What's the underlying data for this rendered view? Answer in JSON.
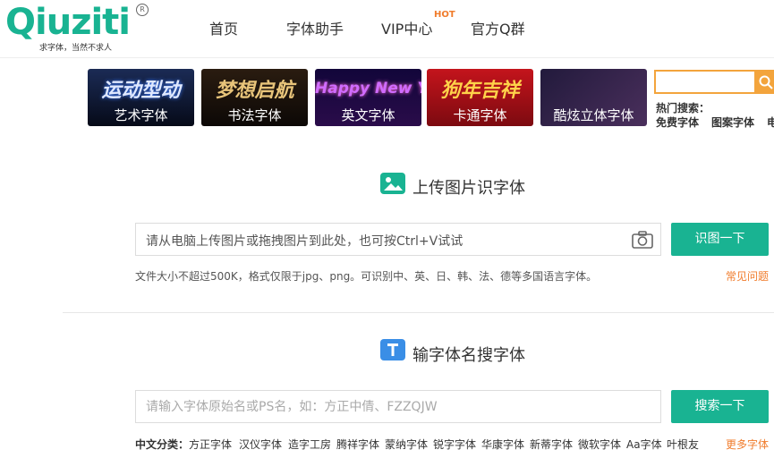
{
  "brand": {
    "name": "Qiuziti",
    "slogan": "求字体，当然不求人",
    "registered": "R"
  },
  "nav": {
    "items": [
      "首页",
      "字体助手",
      "VIP中心",
      "官方Q群"
    ],
    "hot_badge": "HOT"
  },
  "banners": [
    {
      "art": "运动型动",
      "caption": "艺术字体"
    },
    {
      "art": "梦想启航",
      "caption": "书法字体"
    },
    {
      "art": "Happy New Year",
      "caption": "英文字体"
    },
    {
      "art": "狗年吉祥",
      "caption": "卡通字体"
    },
    {
      "art": "",
      "caption": "酷炫立体字体"
    }
  ],
  "hot_search": {
    "label": "热门搜索：",
    "links": [
      "免费字体",
      "图案字体",
      "电"
    ]
  },
  "upload_section": {
    "title": "上传图片识字体",
    "placeholder": "请从电脑上传图片或拖拽图片到此处，也可按Ctrl+V试试",
    "button": "识图一下",
    "note": "文件大小不超过500K，格式仅限于jpg、png。可识别中、英、日、韩、法、德等多国语言字体。",
    "faq": "常见问题"
  },
  "name_section": {
    "title": "输字体名搜字体",
    "placeholder": "请输入字体原始名或PS名，如：方正中倩、FZZQJW",
    "button": "搜索一下",
    "category_label": "中文分类：",
    "categories": [
      "方正字体",
      "汉仪字体",
      "造字工房",
      "腾祥字体",
      "蒙纳字体",
      "锐字字体",
      "华康字体",
      "新蒂字体",
      "微软字体",
      "Aa字体",
      "叶根友"
    ],
    "more": "更多字体"
  },
  "colors": {
    "brand_green": "#19b392",
    "accent_orange": "#f3a43c",
    "link_orange": "#f07c2c"
  }
}
